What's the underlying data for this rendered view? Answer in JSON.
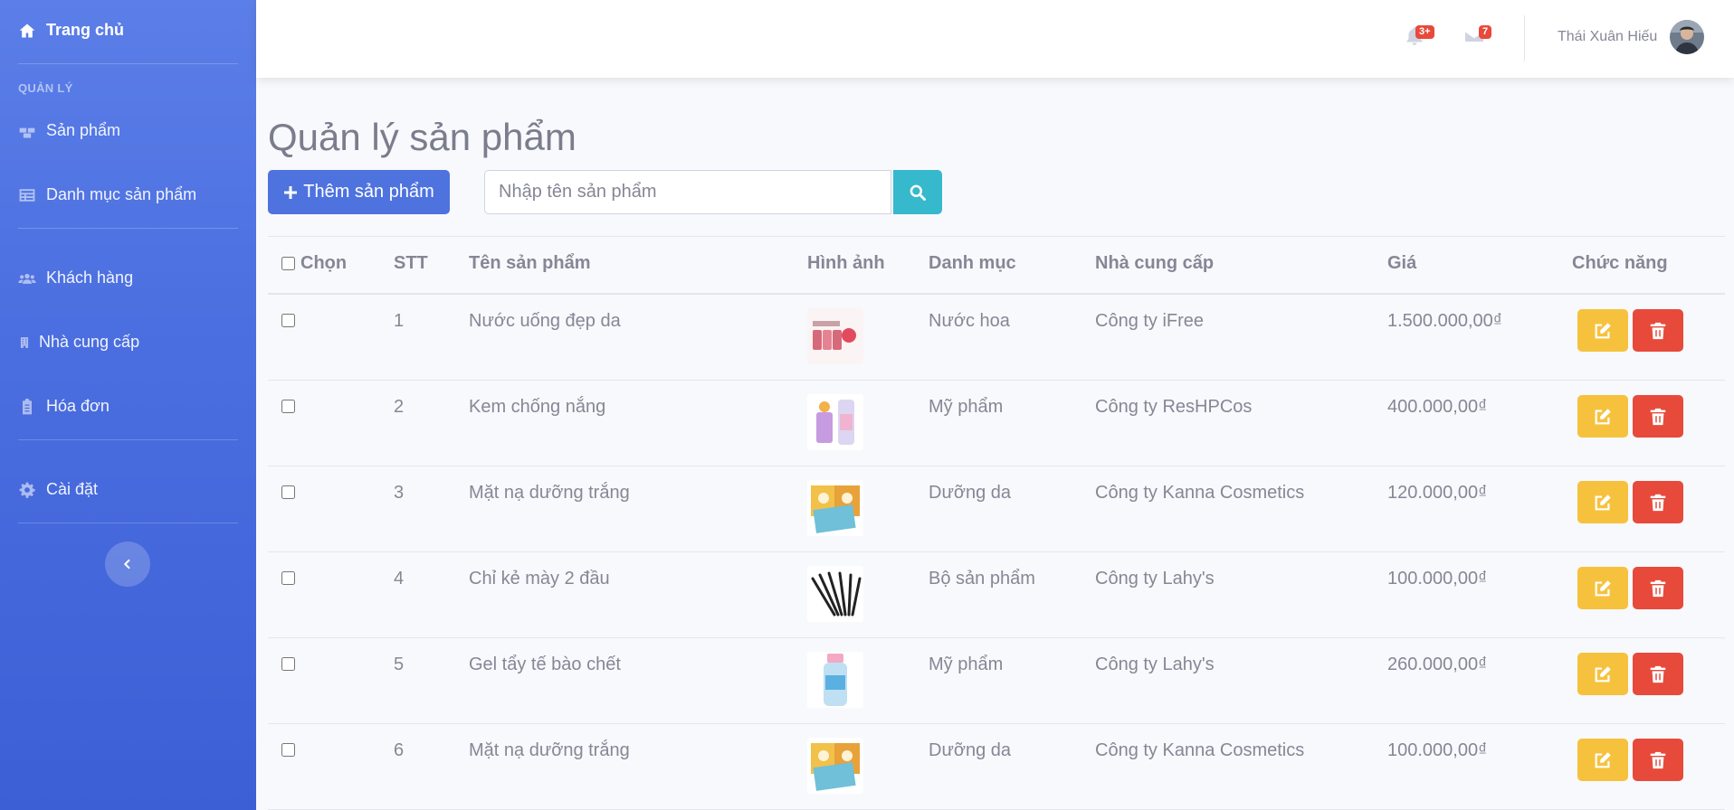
{
  "sidebar": {
    "home": "Trang chủ",
    "section_heading": "QUẢN LÝ",
    "items": [
      {
        "label": "Sản phẩm"
      },
      {
        "label": "Danh mục sản phẩm"
      },
      {
        "label": "Khách hàng"
      },
      {
        "label": "Nhà cung cấp"
      },
      {
        "label": "Hóa đơn"
      },
      {
        "label": "Cài đặt"
      }
    ]
  },
  "topbar": {
    "notifications_badge": "3+",
    "messages_badge": "7",
    "user_name": "Thái Xuân Hiếu"
  },
  "main": {
    "title": "Quản lý sản phẩm",
    "add_button": "Thêm sản phẩm",
    "search_placeholder": "Nhập tên sản phẩm"
  },
  "table": {
    "headers": [
      "Chọn",
      "STT",
      "Tên sản phẩm",
      "Hình ảnh",
      "Danh mục",
      "Nhà cung cấp",
      "Giá",
      "Chức năng"
    ],
    "rows": [
      {
        "stt": "1",
        "name": "Nước uống đẹp da",
        "category": "Nước hoa",
        "supplier": "Công ty iFree",
        "price": "1.500.000,00₫",
        "image": "drink-bottles"
      },
      {
        "stt": "2",
        "name": "Kem chống nắng",
        "category": "Mỹ phẩm",
        "supplier": "Công ty ResHPCos",
        "price": "400.000,00₫",
        "image": "sunscreen-tubes"
      },
      {
        "stt": "3",
        "name": "Mặt nạ dưỡng trắng",
        "category": "Dưỡng da",
        "supplier": "Công ty Kanna Cosmetics",
        "price": "120.000,00₫",
        "image": "face-mask-packs"
      },
      {
        "stt": "4",
        "name": "Chỉ kẻ mày 2 đầu",
        "category": "Bộ sản phẩm",
        "supplier": "Công ty Lahy's",
        "price": "100.000,00₫",
        "image": "brow-pencils"
      },
      {
        "stt": "5",
        "name": "Gel tẩy tế bào chết",
        "category": "Mỹ phẩm",
        "supplier": "Công ty Lahy's",
        "price": "260.000,00₫",
        "image": "gel-bottle"
      },
      {
        "stt": "6",
        "name": "Mặt nạ dưỡng trắng",
        "category": "Dưỡng da",
        "supplier": "Công ty Kanna Cosmetics",
        "price": "100.000,00₫",
        "image": "face-mask-packs"
      }
    ]
  },
  "colors": {
    "primary": "#4e73df",
    "info": "#36b9cc",
    "warning": "#f6c23e",
    "danger": "#e74a3b",
    "text": "#858796",
    "background": "#f8f9fc"
  }
}
